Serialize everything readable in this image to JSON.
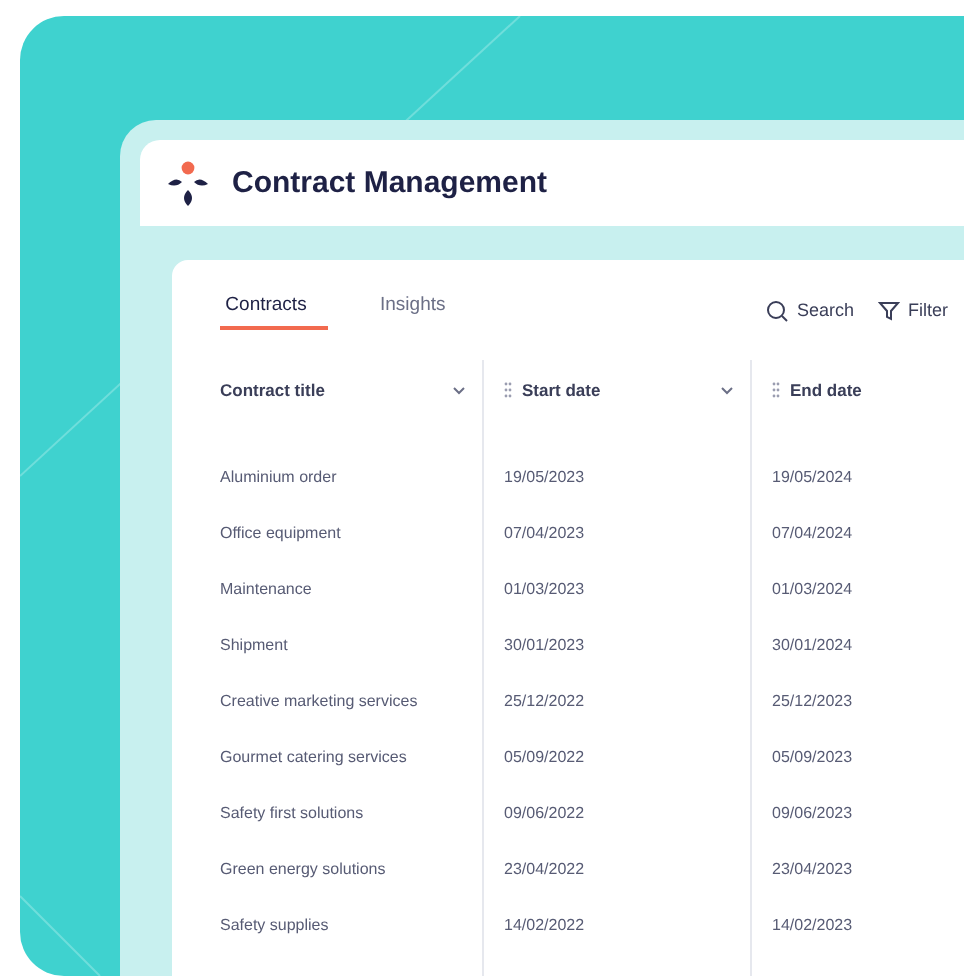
{
  "app": {
    "title": "Contract Management"
  },
  "tabs": [
    {
      "label": "Contracts",
      "selected": true
    },
    {
      "label": "Insights",
      "selected": false
    }
  ],
  "toolbar": {
    "search": "Search",
    "filter": "Filter"
  },
  "table": {
    "columns": [
      {
        "label": "Contract title",
        "drag_handle": false,
        "menu": true
      },
      {
        "label": "Start date",
        "drag_handle": true,
        "menu": true
      },
      {
        "label": "End date",
        "drag_handle": true,
        "menu": false
      }
    ],
    "rows": [
      [
        "Aluminium order",
        "19/05/2023",
        "19/05/2024"
      ],
      [
        "Office equipment",
        "07/04/2023",
        "07/04/2024"
      ],
      [
        "Maintenance",
        "01/03/2023",
        "01/03/2024"
      ],
      [
        "Shipment",
        "30/01/2023",
        "30/01/2024"
      ],
      [
        "Creative marketing services",
        "25/12/2022",
        "25/12/2023"
      ],
      [
        "Gourmet catering services",
        "05/09/2022",
        "05/09/2023"
      ],
      [
        "Safety first solutions",
        "09/06/2022",
        "09/06/2023"
      ],
      [
        "Green energy solutions",
        "23/04/2022",
        "23/04/2023"
      ],
      [
        "Safety supplies",
        "14/02/2022",
        "14/02/2023"
      ]
    ]
  }
}
